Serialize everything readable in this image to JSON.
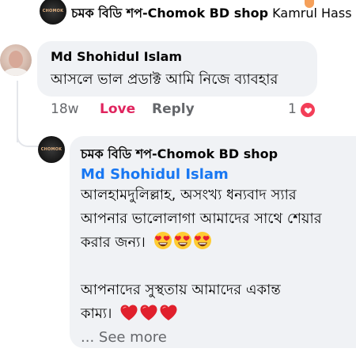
{
  "top_reply": {
    "author": "চমক বিডি শপ-Chomok BD shop",
    "mention_clip": "Kamrul Hass"
  },
  "comment": {
    "author": "Md Shohidul Islam",
    "text": "আসলে ভাল প্রডাক্ট আমি নিজে ব্যাবহার",
    "time": "18w",
    "love_label": "Love",
    "reply_label": "Reply",
    "reaction_count": "1"
  },
  "reply": {
    "author": "চমক বিডি শপ-Chomok BD shop",
    "mention": "Md Shohidul Islam",
    "line1": "আলহামদুলিল্লাহ, অসংখ্য ধন্যবাদ স্যার",
    "line2": "আপনার ভালোলাগা আমাদের সাথে শেয়ার",
    "line3": "করার জন্য।",
    "line4": "আপনাদের সুস্থতায় আমাদের একান্ত",
    "line5": "কাম্য।",
    "see_more": "... See more",
    "emoji_after_line3": "heart-eyes-emoji",
    "emoji_after_line5": "red-heart-emoji"
  },
  "colors": {
    "love": "#e0245e",
    "mention": "#1877f2",
    "bubble": "#f0f2f5",
    "meta": "#65676b",
    "reaction": "#f33e58"
  }
}
